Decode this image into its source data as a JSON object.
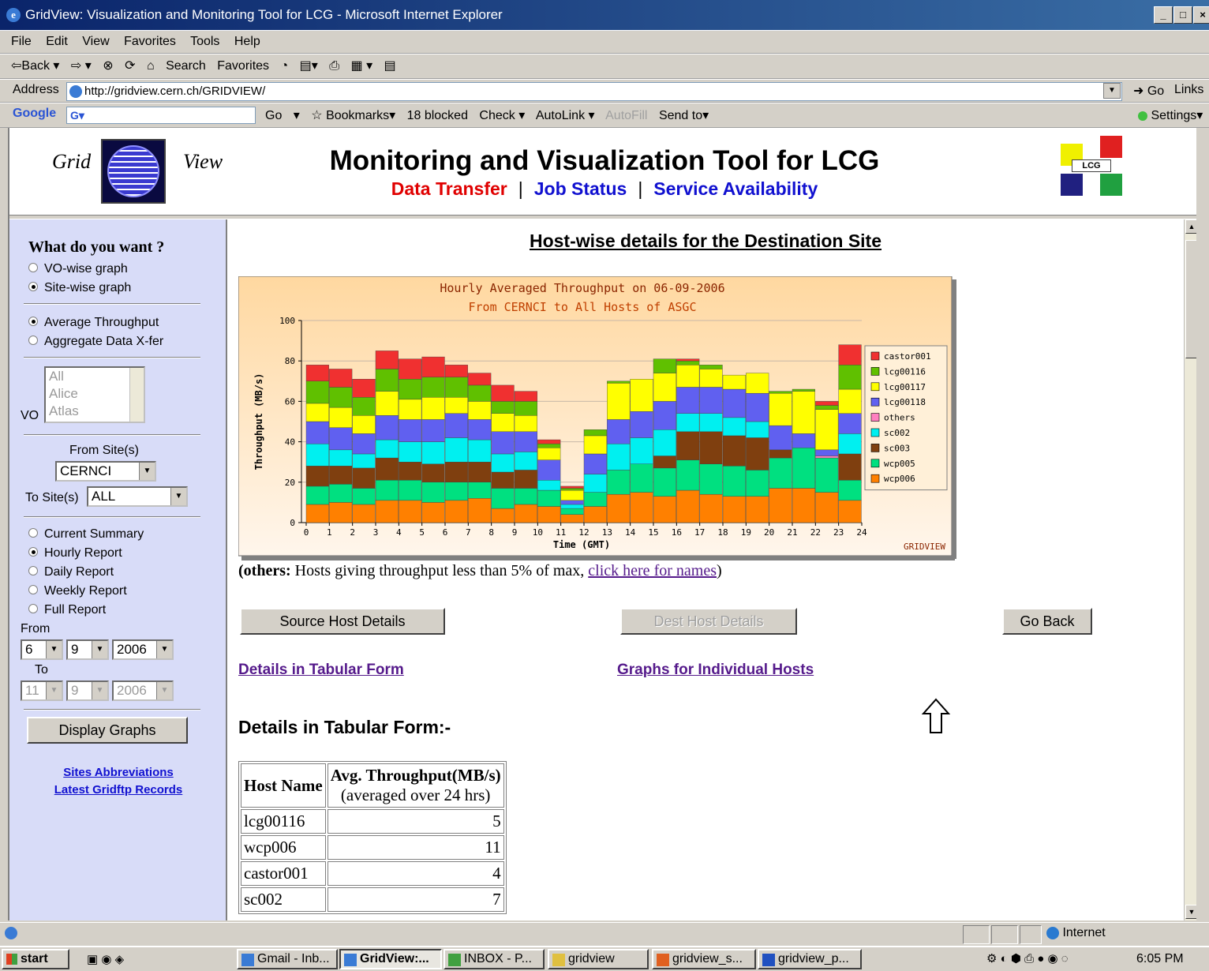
{
  "window": {
    "title": "GridView: Visualization and Monitoring Tool for LCG - Microsoft Internet Explorer",
    "minimize": "_",
    "restore": "□",
    "close": "×"
  },
  "menu": [
    "File",
    "Edit",
    "View",
    "Favorites",
    "Tools",
    "Help"
  ],
  "toolbar": [
    "⇦Back ▾",
    "⇨ ▾",
    "⊗",
    "⟳",
    "⌂",
    "Search",
    "Favorites",
    "◔",
    "▤▾",
    "⎙",
    "▦ ▾",
    "▤"
  ],
  "address": {
    "label": "Address",
    "url": "http://gridview.cern.ch/GRIDVIEW/",
    "go": "Go",
    "links": "Links"
  },
  "googlebar": {
    "logo": "Google",
    "box": "G▾",
    "items": [
      "Go",
      "▾",
      "☆ Bookmarks▾",
      "18 blocked",
      "Check ▾",
      "AutoLink ▾",
      "AutoFill",
      "Send to▾"
    ],
    "settings": "Settings▾"
  },
  "header": {
    "logo_left": "Grid",
    "logo_right": "View",
    "title": "Monitoring and Visualization Tool for LCG",
    "nav_data_transfer": "Data Transfer",
    "nav_job_status": "Job Status",
    "nav_service_availability": "Service Availability",
    "nav_sep": "|",
    "lcg_logo": "LCG"
  },
  "left": {
    "heading": "What do you want ?",
    "graph_type": [
      "VO-wise graph",
      "Site-wise graph"
    ],
    "measure": [
      "Average Throughput",
      "Aggregate Data X-fer"
    ],
    "vo_label": "VO",
    "vo_list": [
      "All",
      "Alice",
      "Atlas"
    ],
    "from_site_label": "From Site(s)",
    "from_site_value": "CERNCI",
    "to_site_label": "To Site(s)",
    "to_site_value": "ALL",
    "reports": [
      "Current Summary",
      "Hourly Report",
      "Daily Report",
      "Weekly Report",
      "Full Report"
    ],
    "from_label": "From",
    "from_date": [
      "6",
      "9",
      "2006"
    ],
    "to_label": "To",
    "to_date": [
      "11",
      "9",
      "2006"
    ],
    "display_button": "Display Graphs",
    "link_abbrev": "Sites Abbreviations",
    "link_records": "Latest Gridftp Records"
  },
  "content": {
    "title": "Host-wise details for the Destination Site",
    "others_bold": "(others:",
    "others_text": " Hosts giving throughput less than 5% of max, ",
    "others_link": "click here for names",
    "others_close": ")",
    "btn_source": "Source Host Details",
    "btn_dest": "Dest Host Details",
    "btn_back": "Go Back",
    "link_tabular": "Details in Tabular Form",
    "link_graphs": "Graphs for Individual Hosts",
    "tab_heading": "Details in Tabular Form:-",
    "table": {
      "col1": "Host Name",
      "col2": "Avg. Throughput(MB/s)",
      "col2_sub": "(averaged over 24 hrs)",
      "rows": [
        {
          "host": "lcg00116",
          "value": "5"
        },
        {
          "host": "wcp006",
          "value": "11"
        },
        {
          "host": "castor001",
          "value": "4"
        },
        {
          "host": "sc002",
          "value": "7"
        }
      ]
    }
  },
  "chart_data": {
    "type": "bar",
    "stacked": true,
    "title": "Hourly Averaged Throughput on 06-09-2006",
    "subtitle": "From CERNCI to All Hosts of ASGC",
    "xlabel": "Time (GMT)",
    "ylabel": "Throughput (MB/s)",
    "ylim": [
      0,
      100
    ],
    "yticks": [
      0,
      20,
      40,
      60,
      80,
      100
    ],
    "x_ticks": [
      "0",
      "1",
      "2",
      "3",
      "4",
      "5",
      "6",
      "7",
      "8",
      "9",
      "10",
      "11",
      "12",
      "13",
      "14",
      "15",
      "16",
      "17",
      "18",
      "19",
      "20",
      "21",
      "22",
      "23",
      "24"
    ],
    "categories": [
      "0",
      "1",
      "2",
      "3",
      "4",
      "5",
      "6",
      "7",
      "8",
      "9",
      "10",
      "11",
      "12",
      "13",
      "14",
      "15",
      "16",
      "17",
      "18",
      "19",
      "20",
      "21",
      "22",
      "23"
    ],
    "watermark": "GRIDVIEW",
    "legend_position": "right",
    "series": [
      {
        "name": "wcp006",
        "color": "#ff8000",
        "values": [
          9,
          10,
          9,
          11,
          11,
          10,
          11,
          12,
          7,
          9,
          8,
          4,
          8,
          14,
          15,
          13,
          16,
          14,
          13,
          13,
          17,
          17,
          15,
          11
        ]
      },
      {
        "name": "wcp005",
        "color": "#00e080",
        "values": [
          9,
          9,
          8,
          10,
          10,
          10,
          9,
          8,
          10,
          8,
          8,
          3,
          7,
          12,
          14,
          14,
          15,
          15,
          15,
          13,
          15,
          20,
          17,
          10
        ]
      },
      {
        "name": "sc003",
        "color": "#7f3f0f",
        "values": [
          10,
          9,
          10,
          11,
          9,
          9,
          10,
          10,
          8,
          9,
          0,
          0,
          0,
          0,
          0,
          6,
          14,
          16,
          15,
          16,
          4,
          0,
          0,
          13
        ]
      },
      {
        "name": "sc002",
        "color": "#00f0f0",
        "values": [
          11,
          8,
          7,
          9,
          10,
          11,
          12,
          11,
          9,
          9,
          5,
          2,
          9,
          13,
          13,
          13,
          9,
          9,
          9,
          8,
          0,
          0,
          0,
          10
        ]
      },
      {
        "name": "others",
        "color": "#ff80c0",
        "values": [
          0,
          0,
          0,
          0,
          0,
          0,
          0,
          0,
          0,
          0,
          0,
          0,
          0,
          0,
          0,
          0,
          0,
          0,
          0,
          0,
          0,
          0,
          1,
          0
        ]
      },
      {
        "name": "lcg00118",
        "color": "#6060f0",
        "values": [
          11,
          11,
          10,
          12,
          11,
          11,
          12,
          10,
          11,
          10,
          10,
          2,
          10,
          12,
          13,
          14,
          13,
          13,
          14,
          14,
          12,
          7,
          3,
          10
        ]
      },
      {
        "name": "lcg00117",
        "color": "#ffff00",
        "values": [
          9,
          10,
          9,
          12,
          10,
          11,
          8,
          9,
          9,
          8,
          6,
          5,
          9,
          18,
          16,
          14,
          11,
          9,
          7,
          10,
          16,
          21,
          20,
          12
        ]
      },
      {
        "name": "lcg00116",
        "color": "#60c000",
        "values": [
          11,
          10,
          9,
          11,
          10,
          10,
          10,
          8,
          6,
          7,
          2,
          1,
          3,
          1,
          0,
          7,
          2,
          2,
          0,
          0,
          1,
          1,
          2,
          12
        ]
      },
      {
        "name": "castor001",
        "color": "#f03030",
        "values": [
          8,
          9,
          9,
          9,
          10,
          10,
          6,
          6,
          8,
          5,
          2,
          1,
          0,
          0,
          0,
          0,
          1,
          0,
          0,
          0,
          0,
          0,
          2,
          10
        ]
      }
    ]
  },
  "status": {
    "zone": "Internet"
  },
  "taskbar": {
    "start": "start",
    "tasks": [
      "Gmail - Inb...",
      "GridView:...",
      "INBOX - P...",
      "gridview",
      "gridview_s...",
      "gridview_p..."
    ],
    "clock": "6:05 PM"
  }
}
